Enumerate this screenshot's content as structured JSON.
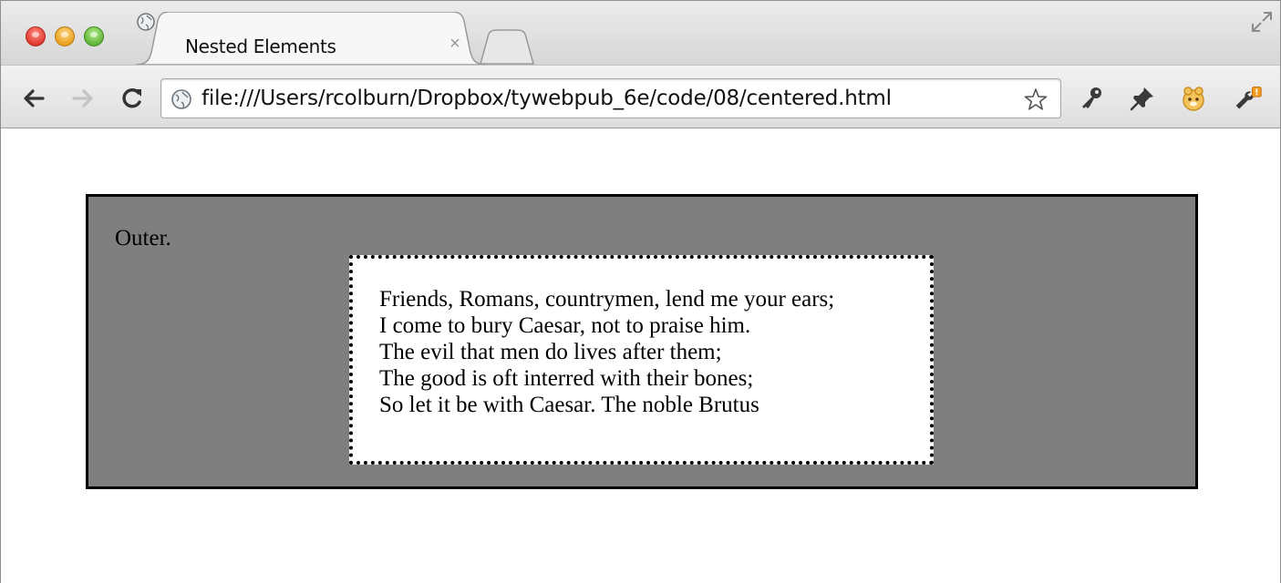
{
  "window": {
    "traffic_lights": [
      "close",
      "minimize",
      "maximize"
    ]
  },
  "tab": {
    "title": "Nested Elements",
    "close_glyph": "×",
    "icon": "globe-icon"
  },
  "toolbar": {
    "url": "file:///Users/rcolburn/Dropbox/tywebpub_6e/code/08/centered.html",
    "icons": [
      "back-icon",
      "forward-icon",
      "reload-icon",
      "globe-icon",
      "star-icon",
      "wrench-key-icon",
      "pin-icon",
      "extension-icon",
      "settings-wrench-icon"
    ]
  },
  "page": {
    "outer_label": "Outer.",
    "quote_lines": [
      "Friends, Romans, countrymen, lend me your ears;",
      "I come to bury Caesar, not to praise him.",
      "The evil that men do lives after them;",
      "The good is oft interred with their bones;",
      "So let it be with Caesar. The noble Brutus"
    ]
  },
  "colors": {
    "outer_background": "#7f7f7f",
    "inner_background": "#ffffff",
    "border": "#000000"
  }
}
